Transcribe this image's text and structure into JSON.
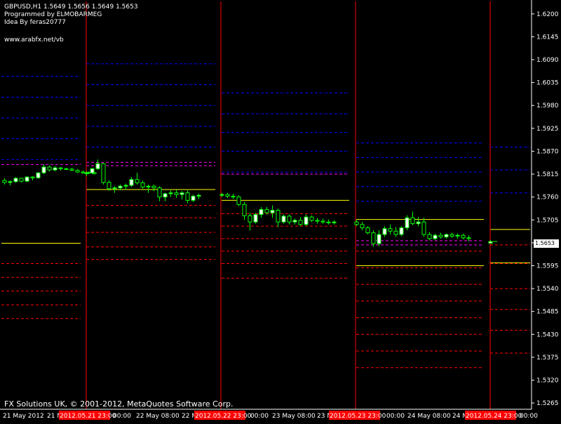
{
  "header": {
    "symbol_line": "GBPUSD,H1  1.5649 1.5656 1.5649 1.5653",
    "programmed_by": "Programmed by ELMOBARMEG",
    "idea_by": "Idea By feras20777",
    "website": "www.arabfx.net/vb"
  },
  "copyright": "FX Solutions UK, © 2001-2012, MetaQuotes Software Corp.",
  "current_price_label": "1.5653",
  "colors": {
    "background": "#000000",
    "bull_candle": "#ffffff",
    "bear_candle": "#000000",
    "wick": "#00ff00",
    "day_separator": "#ff0000",
    "pivot": "#ffff00",
    "support": "#ff0000",
    "resistance": "#0000ff",
    "mid_level": "#ff00ff",
    "time_badge": "#ff0000"
  },
  "chart_data": {
    "type": "candlestick",
    "symbol": "GBPUSD",
    "timeframe": "H1",
    "ylim": [
      1.525,
      1.623
    ],
    "y_ticks": [
      "1.6200",
      "1.6145",
      "1.6090",
      "1.6035",
      "1.5980",
      "1.5925",
      "1.5870",
      "1.5815",
      "1.5760",
      "1.5705",
      "1.5650",
      "1.5595",
      "1.5540",
      "1.5485",
      "1.5430",
      "1.5375",
      "1.5320",
      "1.5265"
    ],
    "x_tick_labels": [
      {
        "label": "21 May 2012",
        "badge": false
      },
      {
        "label": "21 M",
        "badge": false
      },
      {
        "label": "2012.05.21 23:00",
        "badge": true
      },
      {
        "label": "00:00",
        "badge": false
      },
      {
        "label": "22 May 08:00",
        "badge": false
      },
      {
        "label": "22 M",
        "badge": false
      },
      {
        "label": "2012.05.22 23:00",
        "badge": true
      },
      {
        "label": "00:00",
        "badge": false
      },
      {
        "label": "23 May 08:00",
        "badge": false
      },
      {
        "label": "23 M",
        "badge": false
      },
      {
        "label": "2012.05.23 23:00",
        "badge": true
      },
      {
        "label": "00:00",
        "badge": false
      },
      {
        "label": "24 May 08:00",
        "badge": false
      },
      {
        "label": "24 M",
        "badge": false
      },
      {
        "label": "2012.05.24 23:00",
        "badge": true
      },
      {
        "label": "00:00",
        "badge": false
      }
    ],
    "current_price": 1.5653,
    "days": [
      {
        "pivot": 1.5649,
        "support": [
          1.56,
          1.5567,
          1.5534,
          1.5501,
          1.5468
        ],
        "resistance": [
          1.585,
          1.59,
          1.595,
          1.6,
          1.605
        ],
        "mid": [
          1.5838
        ],
        "candles": [
          [
            1.58,
            1.5805,
            1.579,
            1.5795
          ],
          [
            1.5795,
            1.58,
            1.5788,
            1.5797
          ],
          [
            1.5797,
            1.5808,
            1.5794,
            1.5805
          ],
          [
            1.5805,
            1.5806,
            1.5795,
            1.5798
          ],
          [
            1.5798,
            1.581,
            1.5796,
            1.5808
          ],
          [
            1.5808,
            1.581,
            1.58,
            1.5806
          ],
          [
            1.5806,
            1.582,
            1.5804,
            1.5818
          ],
          [
            1.5818,
            1.5838,
            1.5815,
            1.5832
          ],
          [
            1.5832,
            1.5836,
            1.5822,
            1.5825
          ],
          [
            1.5825,
            1.5834,
            1.5822,
            1.583
          ],
          [
            1.583,
            1.5832,
            1.5824,
            1.5828
          ],
          [
            1.5828,
            1.583,
            1.5825,
            1.5827
          ],
          [
            1.5827,
            1.583,
            1.5822,
            1.5824
          ],
          [
            1.5824,
            1.5827,
            1.5818,
            1.582
          ],
          [
            1.582,
            1.5824,
            1.5816,
            1.5818
          ],
          [
            1.5818,
            1.5821,
            1.5815,
            1.5819
          ],
          [
            1.5819,
            1.5821,
            1.5814,
            1.5816
          ]
        ]
      },
      {
        "pivot": 1.5778,
        "support": [
          1.574,
          1.571,
          1.5675,
          1.564,
          1.561
        ],
        "resistance": [
          1.588,
          1.593,
          1.598,
          1.603,
          1.608
        ],
        "mid": [
          1.5843,
          1.5835
        ],
        "candles": [
          [
            1.5816,
            1.5822,
            1.581,
            1.5818
          ],
          [
            1.5818,
            1.583,
            1.5815,
            1.5828
          ],
          [
            1.5828,
            1.585,
            1.5825,
            1.584
          ],
          [
            1.584,
            1.5842,
            1.579,
            1.5795
          ],
          [
            1.5795,
            1.58,
            1.5775,
            1.578
          ],
          [
            1.578,
            1.5786,
            1.577,
            1.5782
          ],
          [
            1.5782,
            1.579,
            1.5776,
            1.5786
          ],
          [
            1.5786,
            1.5792,
            1.5778,
            1.5788
          ],
          [
            1.5788,
            1.5808,
            1.5784,
            1.5802
          ],
          [
            1.5802,
            1.5818,
            1.579,
            1.5794
          ],
          [
            1.5794,
            1.58,
            1.578,
            1.5784
          ],
          [
            1.5784,
            1.579,
            1.577,
            1.5786
          ],
          [
            1.5786,
            1.579,
            1.5774,
            1.5782
          ],
          [
            1.5782,
            1.5786,
            1.575,
            1.576
          ],
          [
            1.576,
            1.577,
            1.575,
            1.5768
          ],
          [
            1.5768,
            1.5776,
            1.576,
            1.577
          ],
          [
            1.577,
            1.5778,
            1.5758,
            1.5766
          ],
          [
            1.5766,
            1.5774,
            1.5754,
            1.577
          ],
          [
            1.577,
            1.5776,
            1.5745,
            1.5752
          ],
          [
            1.5752,
            1.5766,
            1.5748,
            1.5762
          ],
          [
            1.5762,
            1.5768,
            1.5755,
            1.5764
          ]
        ]
      },
      {
        "pivot": 1.5752,
        "support": [
          1.572,
          1.569,
          1.566,
          1.563,
          1.56,
          1.5565
        ],
        "resistance": [
          1.582,
          1.587,
          1.5915,
          1.596,
          1.601
        ],
        "mid": [
          1.5815
        ],
        "candles": [
          [
            1.5764,
            1.577,
            1.576,
            1.5766
          ],
          [
            1.5766,
            1.577,
            1.5758,
            1.5762
          ],
          [
            1.5762,
            1.5768,
            1.5755,
            1.576
          ],
          [
            1.576,
            1.5764,
            1.5738,
            1.5742
          ],
          [
            1.5742,
            1.5748,
            1.5705,
            1.5715
          ],
          [
            1.5715,
            1.5722,
            1.568,
            1.57
          ],
          [
            1.57,
            1.5722,
            1.5696,
            1.5718
          ],
          [
            1.5718,
            1.5736,
            1.571,
            1.573
          ],
          [
            1.573,
            1.5736,
            1.5718,
            1.5722
          ],
          [
            1.5722,
            1.574,
            1.571,
            1.5728
          ],
          [
            1.5728,
            1.5732,
            1.5688,
            1.57
          ],
          [
            1.57,
            1.5718,
            1.5696,
            1.5714
          ],
          [
            1.5714,
            1.5718,
            1.5694,
            1.57
          ],
          [
            1.57,
            1.5708,
            1.5694,
            1.5704
          ],
          [
            1.5704,
            1.5712,
            1.569,
            1.5694
          ],
          [
            1.5694,
            1.5718,
            1.569,
            1.5712
          ],
          [
            1.5712,
            1.5716,
            1.57,
            1.5704
          ],
          [
            1.5704,
            1.571,
            1.5696,
            1.5702
          ],
          [
            1.5702,
            1.5708,
            1.5696,
            1.57
          ],
          [
            1.57,
            1.5706,
            1.5694,
            1.5698
          ],
          [
            1.5698,
            1.5704,
            1.5694,
            1.57
          ]
        ]
      },
      {
        "pivot": 1.5706,
        "support": [
          1.563,
          1.559,
          1.555,
          1.551,
          1.547,
          1.543,
          1.539,
          1.535
        ],
        "resistance": [
          1.589,
          1.5855,
          1.582,
          1.5785,
          1.575
        ],
        "mid": [
          1.5655,
          1.5645
        ],
        "extra_pivot": 1.5595,
        "candles": [
          [
            1.57,
            1.5706,
            1.569,
            1.5694
          ],
          [
            1.5694,
            1.57,
            1.568,
            1.5686
          ],
          [
            1.5686,
            1.569,
            1.567,
            1.5674
          ],
          [
            1.5674,
            1.568,
            1.564,
            1.5648
          ],
          [
            1.5648,
            1.568,
            1.5642,
            1.567
          ],
          [
            1.567,
            1.569,
            1.5664,
            1.5684
          ],
          [
            1.5684,
            1.5694,
            1.567,
            1.5678
          ],
          [
            1.5678,
            1.5688,
            1.5664,
            1.567
          ],
          [
            1.567,
            1.569,
            1.5666,
            1.5686
          ],
          [
            1.5686,
            1.5716,
            1.568,
            1.571
          ],
          [
            1.571,
            1.5725,
            1.5692,
            1.5696
          ],
          [
            1.5696,
            1.5712,
            1.569,
            1.57
          ],
          [
            1.57,
            1.571,
            1.5664,
            1.567
          ],
          [
            1.567,
            1.5676,
            1.5656,
            1.566
          ],
          [
            1.566,
            1.5672,
            1.5656,
            1.5668
          ],
          [
            1.5668,
            1.5674,
            1.566,
            1.5664
          ],
          [
            1.5664,
            1.5672,
            1.566,
            1.567
          ],
          [
            1.567,
            1.5674,
            1.5662,
            1.5666
          ],
          [
            1.5666,
            1.5672,
            1.566,
            1.5668
          ],
          [
            1.5668,
            1.5672,
            1.5658,
            1.5662
          ],
          [
            1.5662,
            1.5668,
            1.5654,
            1.566
          ]
        ]
      },
      {
        "pivot": 1.5682,
        "support": [
          1.5645,
          1.56,
          1.554,
          1.549,
          1.544,
          1.5385
        ],
        "resistance": [
          1.588,
          1.5825,
          1.577
        ],
        "mid": [],
        "extra_pivot": 1.5602,
        "candles": [
          [
            1.5649,
            1.5656,
            1.5649,
            1.5653
          ]
        ]
      }
    ]
  }
}
